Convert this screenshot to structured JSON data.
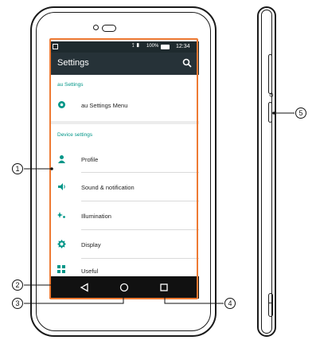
{
  "statusbar": {
    "battery": "100%",
    "time": "12:34"
  },
  "appbar": {
    "title": "Settings"
  },
  "sections": [
    {
      "title": "au Settings",
      "items": [
        {
          "label": "au Settings Menu",
          "icon": "gear-icon"
        }
      ]
    },
    {
      "title": "Device settings",
      "items": [
        {
          "label": "Profile",
          "icon": "person-icon"
        },
        {
          "label": "Sound & notification",
          "icon": "speaker-icon"
        },
        {
          "label": "Illumination",
          "icon": "sparkle-icon"
        },
        {
          "label": "Display",
          "icon": "brightness-icon"
        },
        {
          "label": "Useful",
          "icon": "grid-icon"
        }
      ]
    }
  ],
  "callouts": {
    "c1": "1",
    "c2": "2",
    "c3": "3",
    "c4": "4",
    "c5": "5"
  },
  "colors": {
    "accent": "#009688",
    "appbar": "#263238",
    "highlight": "#ee7a33"
  }
}
